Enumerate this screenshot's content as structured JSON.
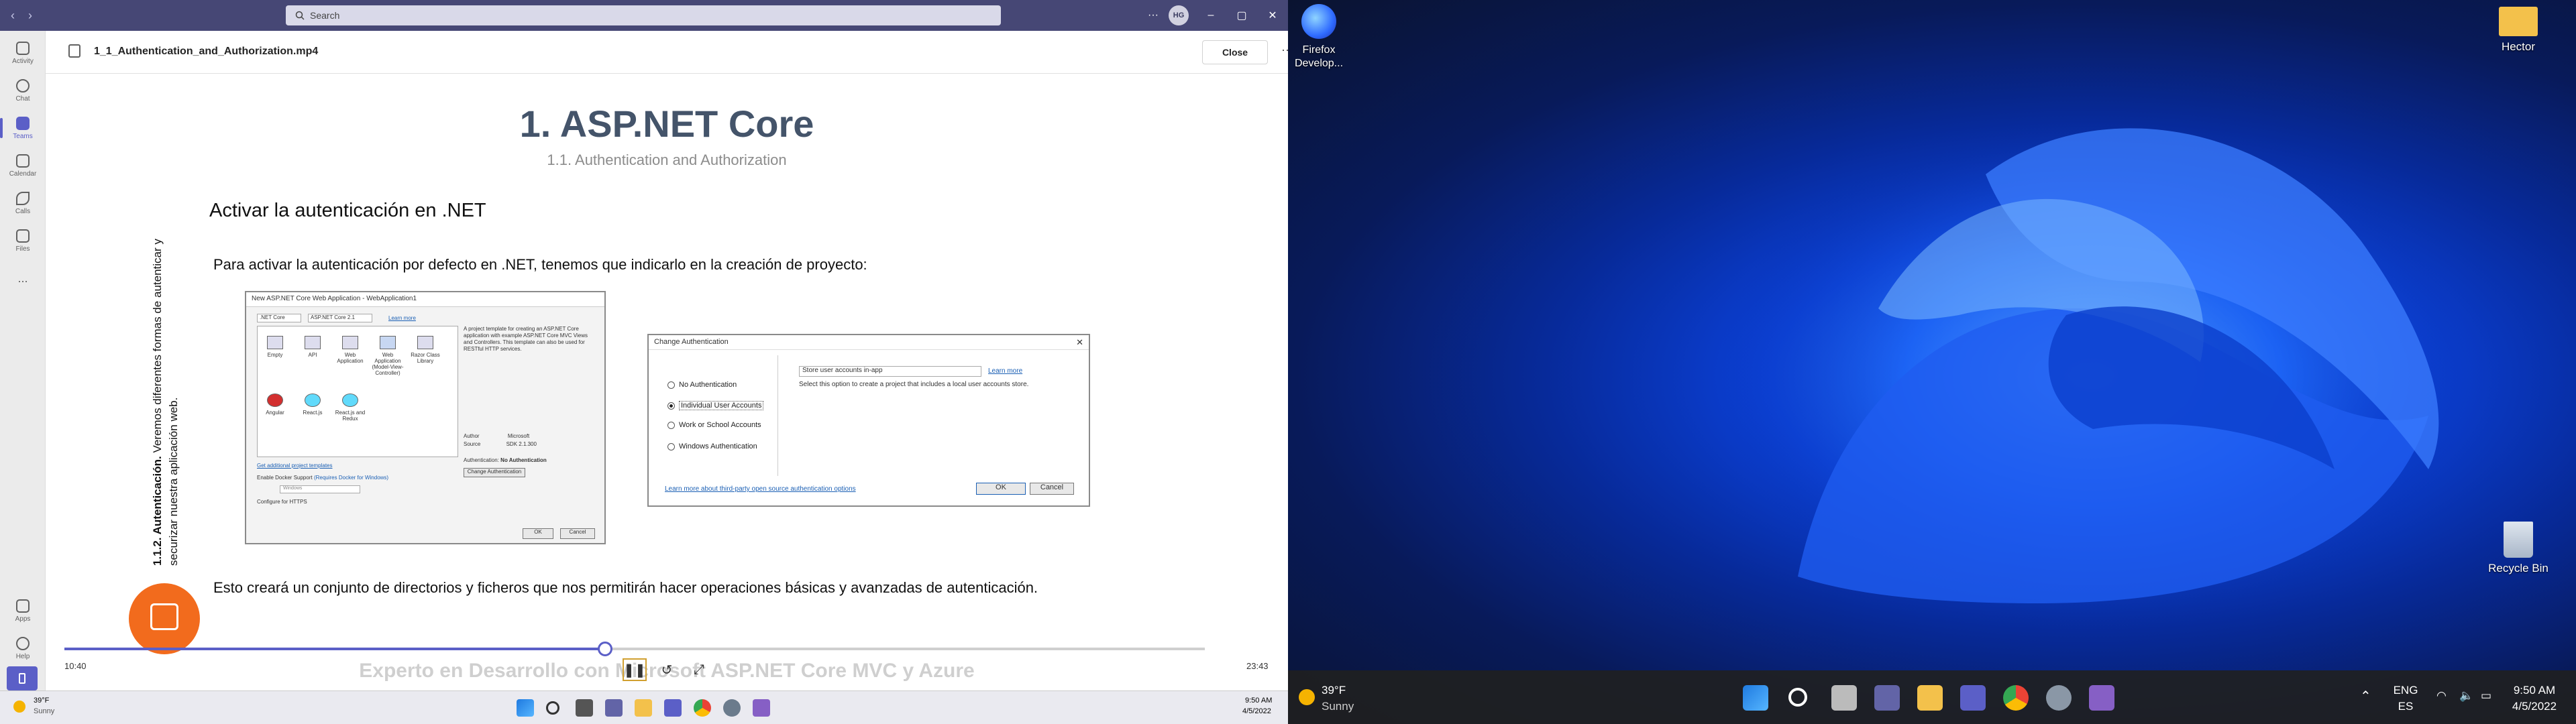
{
  "teams": {
    "search_placeholder": "Search",
    "avatar_initials": "HG",
    "rail": [
      {
        "label": "Activity"
      },
      {
        "label": "Chat"
      },
      {
        "label": "Teams"
      },
      {
        "label": "Calendar"
      },
      {
        "label": "Calls"
      },
      {
        "label": "Files"
      },
      {
        "label": "..."
      },
      {
        "label": "Apps"
      },
      {
        "label": "Help"
      }
    ],
    "file_name": "1_1_Authentication_and_Authorization.mp4",
    "close_label": "Close"
  },
  "slide": {
    "title": "1. ASP.NET Core",
    "subtitle": "1.1. Authentication and Authorization",
    "vertical_text_bold": "1.1.2. Autenticación.",
    "vertical_text": "Veremos diferentes formas de autenticar y securizar nuestra aplicación web.",
    "heading": "Activar la autenticación en .NET",
    "paragraph1": "Para activar la autenticación por defecto en .NET, tenemos que indicarlo en la creación de proyecto:",
    "paragraph2": "Esto creará un conjunto de directorios y ficheros que nos permitirán hacer operaciones básicas y avanzadas de autenticación.",
    "footer_title": "Experto en Desarrollo con Microsoft ASP.NET Core MVC y Azure"
  },
  "dialog_new_project": {
    "title": "New ASP.NET Core Web Application - WebApplication1",
    "framework": ".NET Core",
    "version": "ASP.NET Core 2.1",
    "learn_more": "Learn more",
    "templates": [
      "Empty",
      "API",
      "Web Application",
      "Web Application (Model-View-Controller)",
      "Razor Class Library",
      "Angular",
      "React.js",
      "React.js and Redux"
    ],
    "description": "A project template for creating an ASP.NET Core application with example ASP.NET Core MVC Views and Controllers. This template can also be used for RESTful HTTP services.",
    "get_more": "Get additional project templates",
    "docker": "Enable Docker Support",
    "docker_requires": "(Requires Docker for Windows)",
    "os": "Windows",
    "https": "Configure for HTTPS",
    "author_label": "Author",
    "author": "Microsoft",
    "source_label": "Source",
    "source": "SDK 2.1.300",
    "auth_label": "Authentication:",
    "auth_value": "No Authentication",
    "change_auth": "Change Authentication",
    "ok": "OK",
    "cancel": "Cancel"
  },
  "dialog_change_auth": {
    "title": "Change Authentication",
    "options": [
      "No Authentication",
      "Individual User Accounts",
      "Work or School Accounts",
      "Windows Authentication"
    ],
    "selected_index": 1,
    "store_select": "Store user accounts in-app",
    "learn_more": "Learn more",
    "description": "Select this option to create a project that includes a local user accounts store.",
    "third_party": "Learn more about third-party open source authentication options",
    "ok": "OK",
    "cancel": "Cancel"
  },
  "player": {
    "elapsed": "10:40",
    "duration": "23:43",
    "progress": 0.474
  },
  "taskbar_left": {
    "weather_temp": "39°F",
    "weather_cond": "Sunny",
    "time": "9:50 AM",
    "date": "4/5/2022"
  },
  "desktop_right": {
    "icons": [
      {
        "label": "Firefox Develop..."
      },
      {
        "label": "Hector"
      },
      {
        "label": "Recycle Bin"
      }
    ],
    "weather_temp": "39°F",
    "weather_cond": "Sunny",
    "lang1": "ENG",
    "lang2": "ES",
    "time": "9:50 AM",
    "date": "4/5/2022"
  },
  "colors": {
    "teams_bar": "#464775",
    "accent": "#5b5fc7",
    "slide_title": "#44546a",
    "fab": "#f26b1d"
  }
}
